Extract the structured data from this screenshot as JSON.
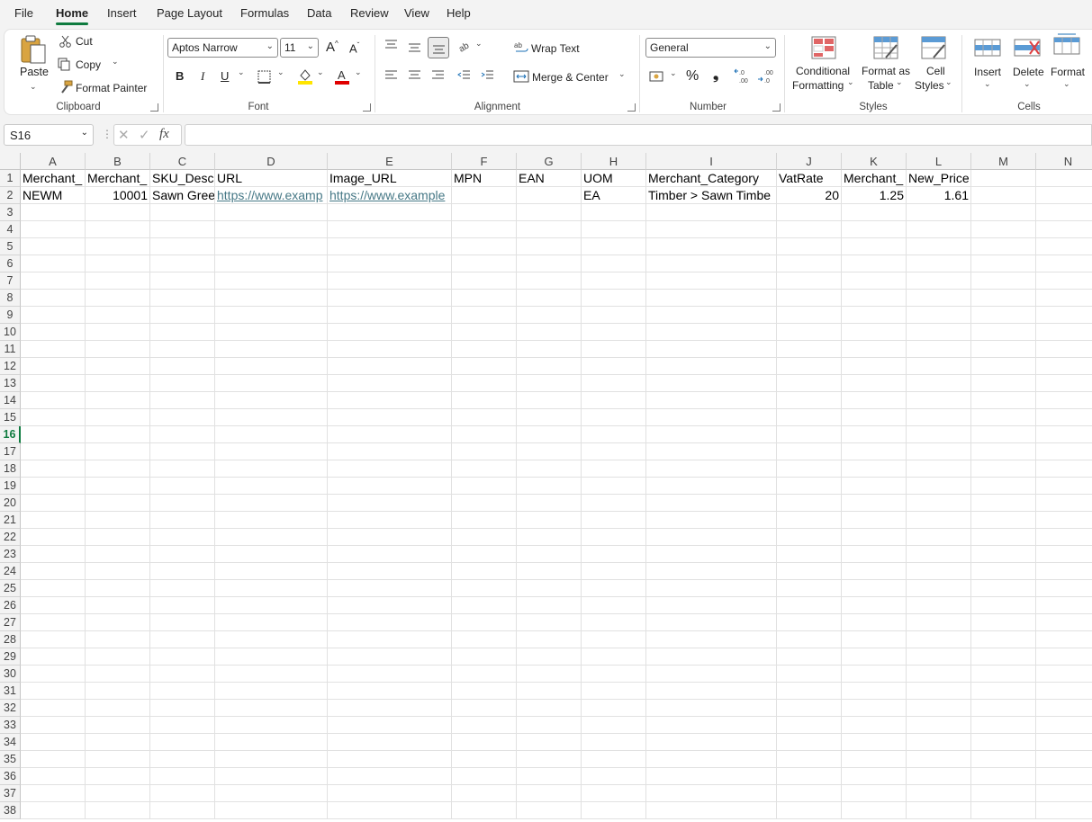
{
  "menu": {
    "tabs": [
      "File",
      "Home",
      "Insert",
      "Page Layout",
      "Formulas",
      "Data",
      "Review",
      "View",
      "Help"
    ],
    "active": "Home"
  },
  "ribbon": {
    "clipboard": {
      "label": "Clipboard",
      "paste": "Paste",
      "cut": "Cut",
      "copy": "Copy",
      "format_painter": "Format Painter"
    },
    "font": {
      "label": "Font",
      "font_name": "Aptos Narrow",
      "font_size": "11",
      "bold": "B",
      "italic": "I",
      "underline": "U",
      "font_color_letter": "A",
      "grow": "A",
      "shrink": "A"
    },
    "alignment": {
      "label": "Alignment",
      "wrap_text": "Wrap Text",
      "merge_center": "Merge & Center"
    },
    "number": {
      "label": "Number",
      "format": "General",
      "percent": "%",
      "comma": "❟"
    },
    "styles": {
      "label": "Styles",
      "conditional_formatting": "Conditional",
      "conditional_formatting_2": "Formatting",
      "format_as_table": "Format as",
      "format_as_table_2": "Table",
      "cell_styles": "Cell",
      "cell_styles_2": "Styles"
    },
    "cells": {
      "label": "Cells",
      "insert": "Insert",
      "delete": "Delete",
      "format": "Format"
    }
  },
  "formula_bar": {
    "name_box": "S16",
    "fx": "fx",
    "formula": ""
  },
  "sheet": {
    "columns": [
      "A",
      "B",
      "C",
      "D",
      "E",
      "F",
      "G",
      "H",
      "I",
      "J",
      "K",
      "L",
      "M",
      "N"
    ],
    "rows": [
      "1",
      "2",
      "3",
      "4",
      "5",
      "6",
      "7",
      "8",
      "9",
      "10",
      "11",
      "12",
      "13",
      "14",
      "15",
      "16",
      "17",
      "18",
      "19",
      "20",
      "21",
      "22",
      "23",
      "24",
      "25",
      "26",
      "27",
      "28",
      "29",
      "30",
      "31",
      "32",
      "33",
      "34",
      "35",
      "36",
      "37",
      "38"
    ],
    "selected_row": "16",
    "header_row": [
      "Merchant_",
      "Merchant_",
      "SKU_Desc",
      "URL",
      "Image_URL",
      "MPN",
      "EAN",
      "UOM",
      "Merchant_Category",
      "VatRate",
      "Merchant_",
      "New_Price"
    ],
    "data_row": [
      "NEWM",
      "10001",
      "Sawn Gree",
      "https://www.examp",
      "https://www.example",
      "",
      "",
      "EA",
      "Timber > Sawn Timbe",
      "20",
      "1.25",
      "1.61"
    ]
  },
  "colors": {
    "accent": "#107c41",
    "link": "#467886",
    "font_color": "#e00000",
    "highlight": "#ffe500"
  }
}
